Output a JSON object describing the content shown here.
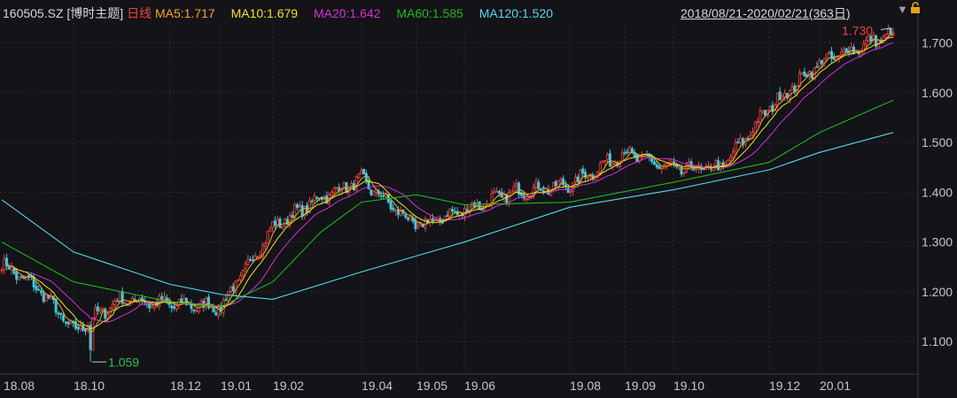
{
  "header": {
    "code": "160505.SZ",
    "theme": "[博时主题]",
    "period": "日线",
    "range": "2018/08/21-2020/02/21(363日)"
  },
  "colors": {
    "background": "#131318",
    "grid": "#2e2e38",
    "up": "#f0453a",
    "down": "#3ec7de",
    "ma5": "#f5a623",
    "ma10": "#ece32e",
    "ma20": "#d431d4",
    "ma60": "#1db81d",
    "ma120": "#54d8e8",
    "low_label": "#30c050",
    "high_label": "#f0453a"
  },
  "chart_data": {
    "type": "candlestick",
    "title": "160505.SZ [博时主题] 日线",
    "ylim": [
      1.04,
      1.74
    ],
    "yticks": [
      "1.700",
      "1.600",
      "1.500",
      "1.400",
      "1.300",
      "1.200",
      "1.100"
    ],
    "xticks": [
      "18.08",
      "18.10",
      "18.12",
      "19.01",
      "19.02",
      "19.04",
      "19.05",
      "19.06",
      "19.08",
      "19.09",
      "19.10",
      "19.12",
      "20.01"
    ],
    "x_range": [
      "2018/08/21",
      "2020/02/21"
    ],
    "grid": true,
    "legend_placement": "top-left",
    "moving_averages": [
      {
        "name": "MA5",
        "label": "MA5:1.717",
        "value": 1.717
      },
      {
        "name": "MA10",
        "label": "MA10:1.679",
        "value": 1.679
      },
      {
        "name": "MA20",
        "label": "MA20:1.642",
        "value": 1.642
      },
      {
        "name": "MA60",
        "label": "MA60:1.585",
        "value": 1.585
      },
      {
        "name": "MA120",
        "label": "MA120:1.520",
        "value": 1.52
      }
    ],
    "annotations": [
      {
        "text": "1.059",
        "kind": "low",
        "value": 1.059,
        "month": "18.10"
      },
      {
        "text": "1.730",
        "kind": "high",
        "value": 1.73,
        "month": "20.02"
      }
    ],
    "monthly_close": [
      {
        "month": "18.08",
        "close": 1.255
      },
      {
        "month": "18.09",
        "close": 1.205
      },
      {
        "month": "18.10",
        "close": 1.12
      },
      {
        "month": "18.11",
        "close": 1.185
      },
      {
        "month": "18.12",
        "close": 1.175
      },
      {
        "month": "19.01",
        "close": 1.17
      },
      {
        "month": "19.02",
        "close": 1.33
      },
      {
        "month": "19.03",
        "close": 1.39
      },
      {
        "month": "19.04",
        "close": 1.425
      },
      {
        "month": "19.05",
        "close": 1.33
      },
      {
        "month": "19.06",
        "close": 1.365
      },
      {
        "month": "19.07",
        "close": 1.4
      },
      {
        "month": "19.08",
        "close": 1.415
      },
      {
        "month": "19.09",
        "close": 1.48
      },
      {
        "month": "19.10",
        "close": 1.445
      },
      {
        "month": "19.11",
        "close": 1.45
      },
      {
        "month": "19.12",
        "close": 1.57
      },
      {
        "month": "20.01",
        "close": 1.66
      },
      {
        "month": "20.02",
        "close": 1.72
      }
    ],
    "ma120_path": [
      {
        "month": "18.08",
        "value": 1.385
      },
      {
        "month": "18.10",
        "value": 1.28
      },
      {
        "month": "18.12",
        "value": 1.215
      },
      {
        "month": "19.01",
        "value": 1.195
      },
      {
        "month": "19.02",
        "value": 1.185
      },
      {
        "month": "19.04",
        "value": 1.24
      },
      {
        "month": "19.06",
        "value": 1.3
      },
      {
        "month": "19.08",
        "value": 1.37
      },
      {
        "month": "19.10",
        "value": 1.405
      },
      {
        "month": "19.12",
        "value": 1.445
      },
      {
        "month": "20.01",
        "value": 1.48
      },
      {
        "month": "20.02",
        "value": 1.52
      }
    ],
    "ma60_path": [
      {
        "month": "18.08",
        "value": 1.3
      },
      {
        "month": "18.10",
        "value": 1.22
      },
      {
        "month": "18.12",
        "value": 1.18
      },
      {
        "month": "19.01",
        "value": 1.17
      },
      {
        "month": "19.02",
        "value": 1.22
      },
      {
        "month": "19.03",
        "value": 1.32
      },
      {
        "month": "19.04",
        "value": 1.38
      },
      {
        "month": "19.05",
        "value": 1.395
      },
      {
        "month": "19.06",
        "value": 1.375
      },
      {
        "month": "19.08",
        "value": 1.38
      },
      {
        "month": "19.10",
        "value": 1.42
      },
      {
        "month": "19.12",
        "value": 1.46
      },
      {
        "month": "20.01",
        "value": 1.52
      },
      {
        "month": "20.02",
        "value": 1.585
      }
    ]
  }
}
